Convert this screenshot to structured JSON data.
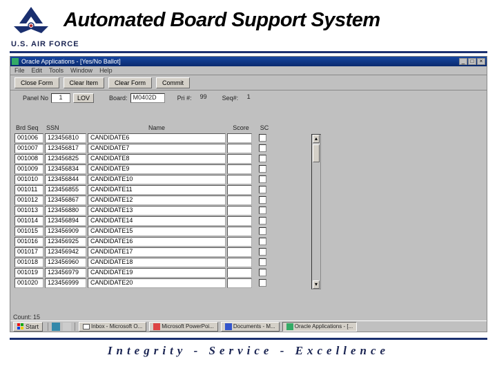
{
  "header": {
    "title": "Automated Board Support System",
    "org": "U.S. AIR FORCE",
    "tagline": "Integrity - Service - Excellence"
  },
  "window": {
    "title": "Oracle Applications - [Yes/No Ballot]",
    "menus": [
      "File",
      "Edit",
      "Tools",
      "Window",
      "Help"
    ],
    "close_form": "Close Form",
    "clear_item": "Clear Item",
    "clear_form": "Clear Form",
    "commit": "Commit"
  },
  "info": {
    "panel_label": "Panel No",
    "panel_value": "1",
    "lov_label": "LOV",
    "board_label": "Board:",
    "board_value": "M0402D",
    "pri_label": "Pri #:",
    "pri_value": "99",
    "seq_label": "Seq#:",
    "seq_value": "1"
  },
  "grid": {
    "headers": {
      "seq": "Brd Seq",
      "ssn": "SSN",
      "name": "Name",
      "score": "Score",
      "sc": "SC"
    },
    "rows": [
      {
        "seq": "001006",
        "ssn": "123456810",
        "name": "CANDIDATE6"
      },
      {
        "seq": "001007",
        "ssn": "123456817",
        "name": "CANDIDATE7"
      },
      {
        "seq": "001008",
        "ssn": "123456825",
        "name": "CANDIDATE8"
      },
      {
        "seq": "001009",
        "ssn": "123456834",
        "name": "CANDIDATE9"
      },
      {
        "seq": "001010",
        "ssn": "123456844",
        "name": "CANDIDATE10"
      },
      {
        "seq": "001011",
        "ssn": "123456855",
        "name": "CANDIDATE11"
      },
      {
        "seq": "001012",
        "ssn": "123456867",
        "name": "CANDIDATE12"
      },
      {
        "seq": "001013",
        "ssn": "123456880",
        "name": "CANDIDATE13"
      },
      {
        "seq": "001014",
        "ssn": "123456894",
        "name": "CANDIDATE14"
      },
      {
        "seq": "001015",
        "ssn": "123456909",
        "name": "CANDIDATE15"
      },
      {
        "seq": "001016",
        "ssn": "123456925",
        "name": "CANDIDATE16"
      },
      {
        "seq": "001017",
        "ssn": "123456942",
        "name": "CANDIDATE17"
      },
      {
        "seq": "001018",
        "ssn": "123456960",
        "name": "CANDIDATE18"
      },
      {
        "seq": "001019",
        "ssn": "123456979",
        "name": "CANDIDATE19"
      },
      {
        "seq": "001020",
        "ssn": "123456999",
        "name": "CANDIDATE20"
      }
    ]
  },
  "status": {
    "count": "Count: 15"
  },
  "taskbar": {
    "start": "Start",
    "items": [
      "Inbox - Microsoft O...",
      "Microsoft PowerPoi...",
      "Documents - M...",
      "Oracle Applications - [..."
    ]
  }
}
